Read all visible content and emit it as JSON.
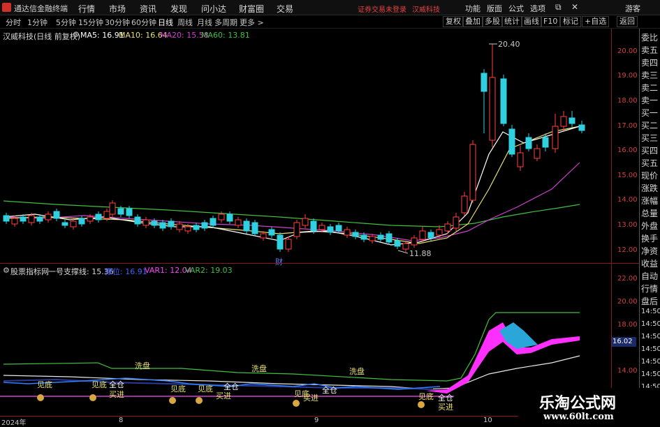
{
  "titlebar": {
    "app_name": "通达信金融终端",
    "menus": [
      "行情",
      "市场",
      "资讯",
      "发现",
      "问小达",
      "财富圈",
      "交易"
    ],
    "login_hint": "证券交易未登录",
    "stock_hint": "汉威科技",
    "buttons": [
      "功能",
      "版面",
      "公式",
      "选项"
    ],
    "guest": "游客"
  },
  "periods": [
    "分时",
    "1分钟",
    "5分钟",
    "15分钟",
    "30分钟",
    "60分钟",
    "日线",
    "周线",
    "月线",
    "多周期",
    "更多 >"
  ],
  "active_period": "日线",
  "right_buttons": [
    "复权",
    "叠加",
    "多股",
    "统计",
    "画线",
    "F10",
    "标记",
    "+自选",
    "返回"
  ],
  "main_legend": {
    "stock": "汉威科技(日线 前复权)",
    "ma5": "MA5: 16.91",
    "ma10": "MA10: 16.64",
    "ma20": "MA20: 15.58",
    "ma60": "MA60: 13.81"
  },
  "price_axis": [
    "20.00",
    "19.00",
    "18.00",
    "17.00",
    "16.00",
    "15.00",
    "14.00",
    "13.00",
    "12.00"
  ],
  "annotations": {
    "high": "20.40",
    "low": "11.88",
    "cai": "财"
  },
  "ind_legend": {
    "name": "股票指标网",
    "line1": "一号支撑线: 15.36",
    "line2": "撑位: 16.91",
    "var1": "VAR1: 12.04",
    "var2": "VAR2: 19.03"
  },
  "ind_axis": [
    "22.00",
    "20.00",
    "18.00",
    "16.00",
    "14.00"
  ],
  "price_tag": "16.02",
  "signals": {
    "xipan": "洗盘",
    "jiandi": "见底",
    "quancang": "全仓",
    "mairu": "买进"
  },
  "side_panel": [
    "委比",
    "卖五",
    "卖四",
    "卖三",
    "卖二",
    "卖一",
    "买一",
    "买二",
    "买三",
    "买四",
    "买五",
    "现价",
    "涨跌",
    "涨幅",
    "总量",
    "外盘",
    "换手",
    "净资",
    "收益",
    "自动",
    "行情",
    "盘后",
    "14:50",
    "14:50",
    "14:50",
    "14:50",
    "14:50",
    "14:50",
    "14:50"
  ],
  "dates": [
    "2024年",
    "8",
    "9",
    "10"
  ],
  "watermark": {
    "title": "乐淘公式网",
    "url": "www.60lt.com"
  },
  "colors": {
    "up": "#ff4040",
    "down": "#30d0e0",
    "ma5": "#ffffff",
    "ma10": "#e8e070",
    "ma20": "#d040d0",
    "ma60": "#40c040"
  }
}
